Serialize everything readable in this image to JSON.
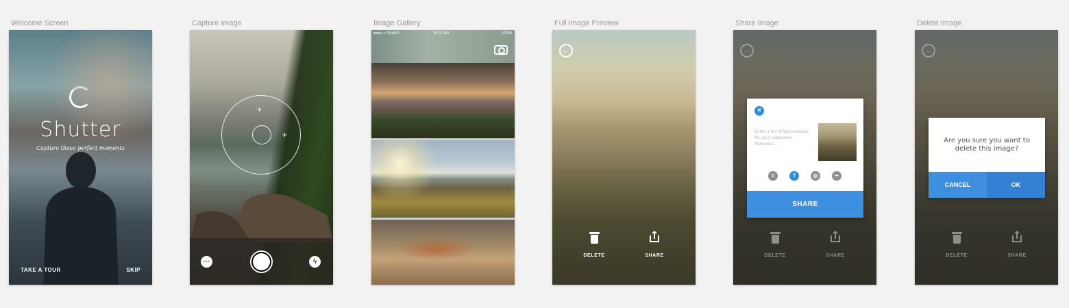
{
  "artboards": {
    "welcome": "Welcome Screen",
    "capture": "Capture Image",
    "gallery": "Image Gallery",
    "preview": "Full Image Preview",
    "share": "Share Image",
    "delete": "Delete Image"
  },
  "welcome": {
    "app_name": "Shutter",
    "tagline": "Capture those perfect moments",
    "take_tour": "TAKE A TOUR",
    "skip": "SKIP"
  },
  "gallery": {
    "status_carrier": "●●●○○ Sketch",
    "status_time": "9:41 AM",
    "status_battery": "100%"
  },
  "preview": {
    "delete_label": "DELETE",
    "share_label": "SHARE"
  },
  "share_modal": {
    "message_placeholder": "Enter a fun-filled message for your awesome followers...",
    "social_icons": [
      "twitter-icon",
      "facebook-icon",
      "instagram-icon",
      "flickr-icon"
    ],
    "share_button": "SHARE"
  },
  "delete_modal": {
    "message": "Are you sure you want to delete this image?",
    "cancel": "CANCEL",
    "ok": "OK"
  },
  "colors": {
    "accent_blue": "#3f8fe0",
    "background": "#f2f2f2"
  }
}
